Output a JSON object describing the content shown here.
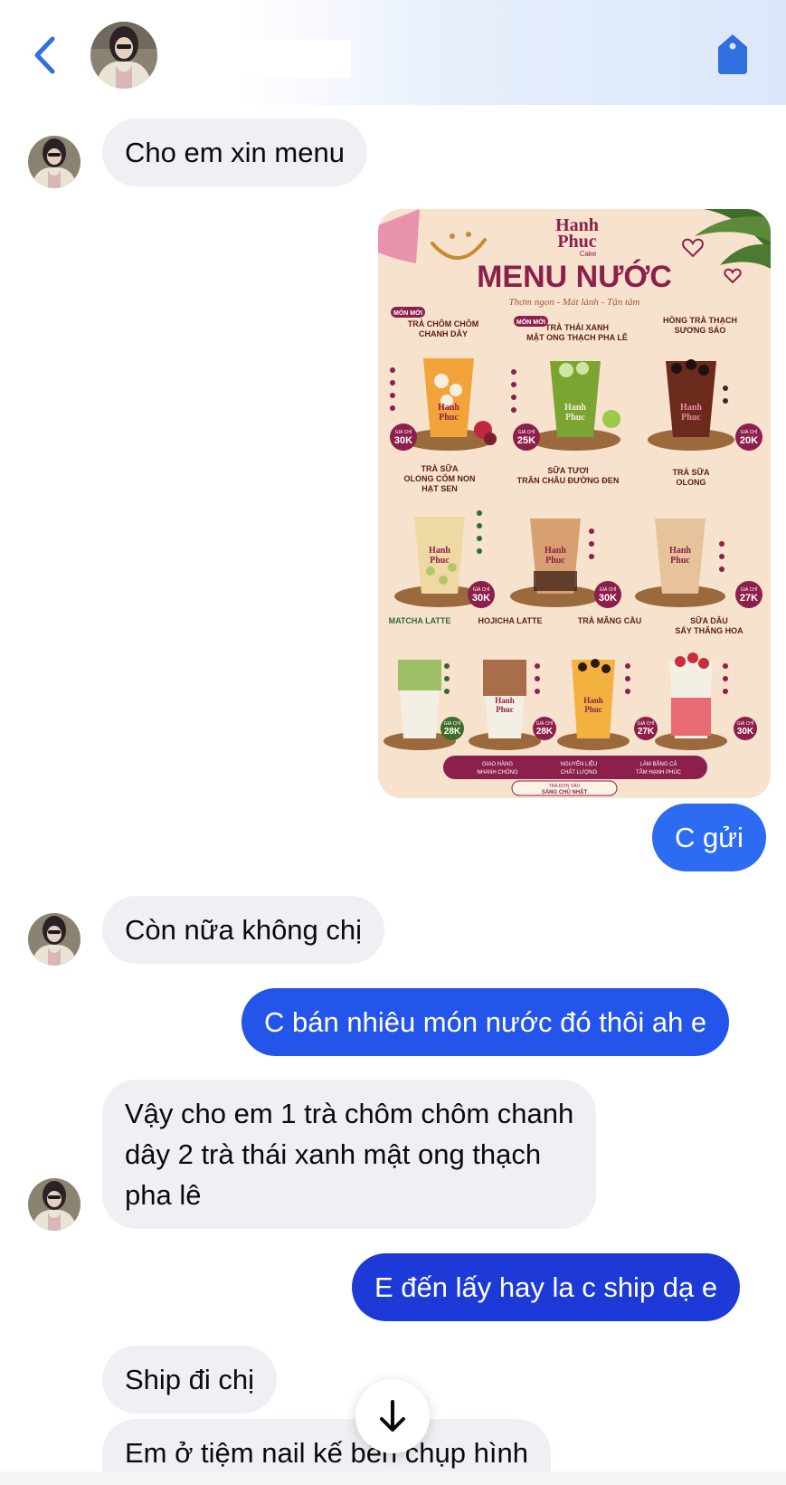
{
  "header": {
    "contact_name": "",
    "icons": {
      "back": "chevron-left-icon",
      "action": "tag-icon"
    },
    "accent": "#2f6fe0"
  },
  "messages": [
    {
      "id": "m1",
      "side": "in",
      "text": "Cho em xin menu"
    },
    {
      "id": "m2",
      "side": "out",
      "type": "image"
    },
    {
      "id": "m3",
      "side": "out",
      "text": "C gửi"
    },
    {
      "id": "m4",
      "side": "in",
      "text": "Còn nữa không chị"
    },
    {
      "id": "m5",
      "side": "out",
      "text": "C bán nhiêu món nước đó thôi ah e"
    },
    {
      "id": "m6",
      "side": "in",
      "lines": [
        "Vậy cho em 1 trà chôm chôm chanh",
        "dây 2 trà thái xanh mật ong thạch",
        "pha lê"
      ]
    },
    {
      "id": "m7",
      "side": "out",
      "text": "E đến lấy hay la c ship dạ e"
    },
    {
      "id": "m8",
      "side": "in",
      "text": "Ship đi chị"
    },
    {
      "id": "m9",
      "side": "in",
      "text": "Em ở tiệm nail kế bên chụp hình"
    }
  ],
  "menu_image": {
    "brand": [
      "Hanh",
      "Phuc",
      "Cake"
    ],
    "title": "MENU NƯỚC",
    "tagline": "Thơm ngon - Mát lành - Tận tâm",
    "new_badge": "MÓN MỚI",
    "price_prefix": "GIÁ CHỈ",
    "cup_label": [
      "Hanh",
      "Phuc"
    ],
    "items": [
      {
        "name": [
          "TRÀ CHÔM CHÔM",
          "CHANH DÂY"
        ],
        "price": "30K",
        "new": true,
        "color": "#f2a43a"
      },
      {
        "name": [
          "TRÀ THÁI XANH",
          "MẬT ONG THẠCH PHA LÊ"
        ],
        "price": "25K",
        "new": true,
        "color": "#7aa533"
      },
      {
        "name": [
          "HỒNG TRÀ THẠCH",
          "SƯƠNG SÁO"
        ],
        "price": "20K",
        "new": false,
        "color": "#6b2a1c"
      },
      {
        "name": [
          "TRÀ SỮA",
          "OLONG CỐM NON",
          "HẠT SEN"
        ],
        "price": "30K",
        "new": false,
        "color": "#efd9a2"
      },
      {
        "name": [
          "SỮA TƯƠI",
          "TRÂN CHÂU ĐƯỜNG ĐEN"
        ],
        "price": "30K",
        "new": false,
        "color": "#d8a070"
      },
      {
        "name": [
          "TRÀ SỮA",
          "OLONG"
        ],
        "price": "27K",
        "new": false,
        "color": "#e6c39a"
      },
      {
        "name": [
          "MATCHA LATTE"
        ],
        "price": "28K",
        "new": false,
        "color": "#9dbf68"
      },
      {
        "name": [
          "HOJICHA LATTE"
        ],
        "price": "28K",
        "new": false,
        "color": "#a86e4a"
      },
      {
        "name": [
          "TRÀ MÃNG CẦU"
        ],
        "price": "27K",
        "new": false,
        "color": "#f3b23f"
      },
      {
        "name": [
          "SỮA DÂU",
          "SẤY THĂNG HOA"
        ],
        "price": "30K",
        "new": false,
        "color": "#e86a74"
      }
    ],
    "footer": [
      [
        "GIAO HÀNG",
        "NHANH CHÓNG"
      ],
      [
        "NGUYÊN LIỆU",
        "CHẤT LƯỢNG"
      ],
      [
        "LÀM BẰNG CẢ",
        "TÂM HẠNH PHÚC"
      ]
    ],
    "footer_note": [
      "TRÀ ĐƠN VÀO",
      "SÁNG CHỦ NHẬT"
    ]
  },
  "colors": {
    "incoming_bubble": "#eff0f4",
    "outgoing_bubble_top": "#2d6cf2",
    "outgoing_bubble_bottom": "#1d34d6",
    "menu_maroon": "#8c1f4b",
    "menu_bg": "#f7e2cd"
  },
  "scroll_button": {
    "icon": "arrow-down-icon"
  }
}
